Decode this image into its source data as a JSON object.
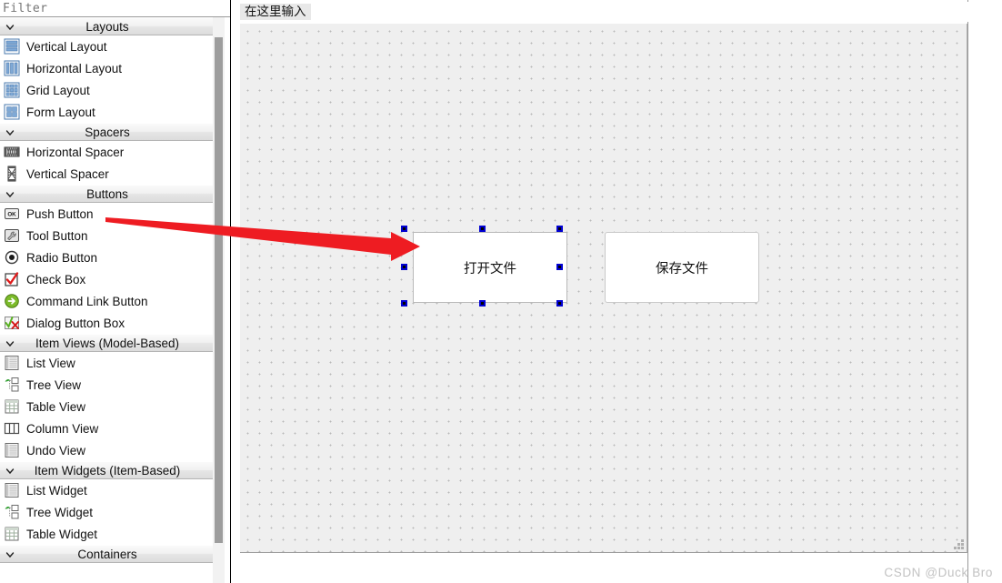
{
  "app": {
    "watermark": "CSDN @Duck Bro"
  },
  "widget_box": {
    "filter": {
      "value": "",
      "placeholder": "Filter"
    },
    "sections": [
      {
        "title": "Layouts",
        "expanded": true,
        "items": [
          {
            "label": "Vertical Layout",
            "icon": "vertical-layout-icon"
          },
          {
            "label": "Horizontal Layout",
            "icon": "horizontal-layout-icon"
          },
          {
            "label": "Grid Layout",
            "icon": "grid-layout-icon"
          },
          {
            "label": "Form Layout",
            "icon": "form-layout-icon"
          }
        ]
      },
      {
        "title": "Spacers",
        "expanded": true,
        "items": [
          {
            "label": "Horizontal Spacer",
            "icon": "horizontal-spacer-icon"
          },
          {
            "label": "Vertical Spacer",
            "icon": "vertical-spacer-icon"
          }
        ]
      },
      {
        "title": "Buttons",
        "expanded": true,
        "items": [
          {
            "label": "Push Button",
            "icon": "push-button-icon"
          },
          {
            "label": "Tool Button",
            "icon": "tool-button-icon"
          },
          {
            "label": "Radio Button",
            "icon": "radio-button-icon"
          },
          {
            "label": "Check Box",
            "icon": "check-box-icon"
          },
          {
            "label": "Command Link Button",
            "icon": "command-link-button-icon"
          },
          {
            "label": "Dialog Button Box",
            "icon": "dialog-button-box-icon"
          }
        ]
      },
      {
        "title": "Item Views (Model-Based)",
        "expanded": true,
        "items": [
          {
            "label": "List View",
            "icon": "list-view-icon"
          },
          {
            "label": "Tree View",
            "icon": "tree-view-icon"
          },
          {
            "label": "Table View",
            "icon": "table-view-icon"
          },
          {
            "label": "Column View",
            "icon": "column-view-icon"
          },
          {
            "label": "Undo View",
            "icon": "undo-view-icon"
          }
        ]
      },
      {
        "title": "Item Widgets (Item-Based)",
        "expanded": true,
        "items": [
          {
            "label": "List Widget",
            "icon": "list-widget-icon"
          },
          {
            "label": "Tree Widget",
            "icon": "tree-widget-icon"
          },
          {
            "label": "Table Widget",
            "icon": "table-widget-icon"
          }
        ]
      },
      {
        "title": "Containers",
        "expanded": true,
        "items": []
      }
    ]
  },
  "editor": {
    "menubar": {
      "type_here": "在这里输入"
    },
    "widgets": [
      {
        "name": "open-file-button",
        "text": "打开文件",
        "selected": true
      },
      {
        "name": "save-file-button",
        "text": "保存文件",
        "selected": false
      }
    ]
  },
  "colors": {
    "selection_handle": "#0000d2",
    "annotation_arrow": "#ee1c22",
    "canvas": "#efefef",
    "watermark": "#c2c2c2"
  }
}
